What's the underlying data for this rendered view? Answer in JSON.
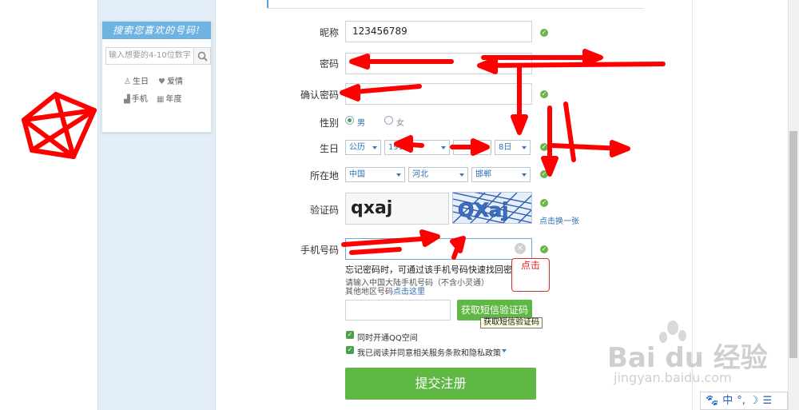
{
  "sidebar": {
    "title": "搜索您喜欢的号码!",
    "search_placeholder": "输入想要的4-10位数字",
    "links": [
      {
        "label": "生日",
        "icon": "cake-icon"
      },
      {
        "label": "爱情",
        "icon": "heart-icon"
      },
      {
        "label": "手机",
        "icon": "signal-icon"
      },
      {
        "label": "年度",
        "icon": "calendar-icon"
      }
    ]
  },
  "form": {
    "nickname_label": "昵称",
    "nickname_value": "123456789",
    "password_label": "密码",
    "confirm_label": "确认密码",
    "gender_label": "性别",
    "gender_male": "男",
    "gender_female": "女",
    "birthday_label": "生日",
    "birthday": {
      "calendar": "公历",
      "year": "1998",
      "month": "",
      "day": "8日"
    },
    "location_label": "所在地",
    "location": {
      "country": "中国",
      "province": "河北",
      "city": "邯郸"
    },
    "captcha_label": "验证码",
    "captcha_value": "qxaj",
    "captcha_refresh": "点击换一张",
    "phone_label": "手机号码",
    "phone_hint": "忘记密码时，可通过该手机号码快速找回密码",
    "phone_note": "请输入中国大陆手机号码（不含小灵通）",
    "phone_other_prefix": "其他地区号码",
    "phone_other_link": "点击这里",
    "sms_button": "获取短信验证码",
    "sms_tooltip": "获取短信验证码",
    "annotation_click": "点击",
    "qzone_checkbox": "同时开通QQ空间",
    "agree_checkbox": "我已阅读并同意相关服务条款和隐私政策",
    "submit_button": "提交注册"
  },
  "watermark": {
    "brand": "Bai du 经验",
    "url": "jingyan.baidu.com"
  },
  "ime_tray": {
    "mode": "中",
    "items": [
      "°,",
      "☽",
      "☰"
    ]
  },
  "colors": {
    "accent_green": "#5fb844",
    "link_blue": "#2d6fb3",
    "annotation_red": "#ff0000",
    "sidebar_title_blue": "#6fb3e3"
  }
}
